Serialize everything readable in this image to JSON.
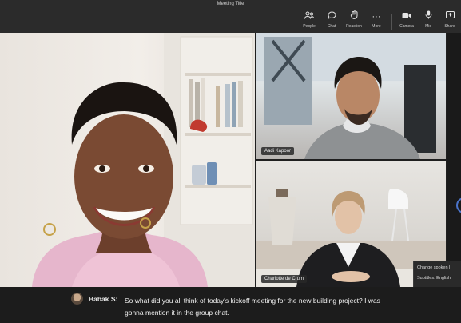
{
  "window": {
    "title": "Meeting Title"
  },
  "toolbar": {
    "people": {
      "label": "People",
      "icon": "people-icon"
    },
    "chat": {
      "label": "Chat",
      "icon": "chat-icon"
    },
    "reactions": {
      "label": "Reaction",
      "icon": "reaction-icon"
    },
    "more": {
      "label": "More",
      "icon": "more-icon"
    },
    "camera": {
      "label": "Camera",
      "icon": "camera-icon"
    },
    "mic": {
      "label": "Mic",
      "icon": "mic-icon"
    },
    "share": {
      "label": "Share",
      "icon": "share-icon"
    }
  },
  "participants": [
    {
      "name": ""
    },
    {
      "name": "Aadi Kapoor"
    },
    {
      "name": "Charlotte de Crum"
    }
  ],
  "caption_menu": {
    "change_language": "Change spoken l",
    "subtitles": "Subtitles: English"
  },
  "captions": {
    "speaker": "Babak S:",
    "text": "So what did you all think of today's kickoff meeting for the new building project? I was gonna mention it in the group chat."
  }
}
